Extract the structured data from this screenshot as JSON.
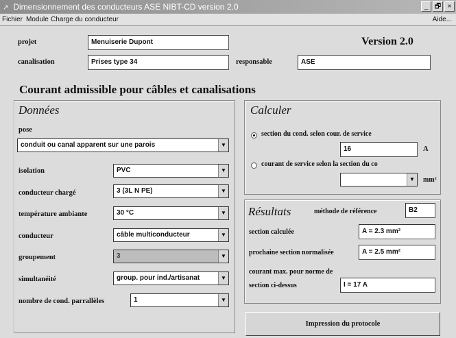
{
  "window": {
    "title": "Dimensionnement des conducteurs ASE NIBT-CD version 2.0",
    "controls": {
      "minimize": "_",
      "maximize": "🗗",
      "close": "×"
    }
  },
  "menu": {
    "file": "Fichier",
    "module": "Module",
    "charge": "Charge du conducteur",
    "help": "Aide..."
  },
  "header": {
    "projet_label": "projet",
    "projet_value": "Menuiserie Dupont",
    "version": "Version 2.0",
    "canalisation_label": "canalisation",
    "canalisation_value": "Prises type 34",
    "responsable_label": "responsable",
    "responsable_value": "ASE"
  },
  "main_title": "Courant admissible pour câbles et canalisations",
  "donnees": {
    "title": "Données",
    "pose_label": "pose",
    "pose_value": "conduit ou canal apparent sur une parois",
    "isolation_label": "isolation",
    "isolation_value": "PVC",
    "conducteur_charge_label": "conducteur chargé",
    "conducteur_charge_value": "3 (3L N PE)",
    "temperature_label": "température ambiante",
    "temperature_value": "30 °C",
    "conducteur_label": "conducteur",
    "conducteur_value": "câble multiconducteur",
    "groupement_label": "groupement",
    "groupement_value": "3",
    "simultaneite_label": "simultanéité",
    "simultaneite_value": "group. pour ind./artisanat",
    "nombre_label": "nombre de cond. parrallèles",
    "nombre_value": "1",
    "arrow_glyph": "▼"
  },
  "calculer": {
    "title": "Calculer",
    "option1": "section du cond. selon cour. de service",
    "courant_value": "16",
    "courant_unit": "A",
    "option2": "courant de service selon la section du co",
    "section_value": "",
    "section_unit": "mm²"
  },
  "resultats": {
    "title": "Résultats",
    "methode_label": "méthode de référence",
    "methode_value": "B2",
    "section_calc_label": "section calculée",
    "section_calc_value": "A = 2.3 mm²",
    "section_norm_label": "prochaine section normalisée",
    "section_norm_value": "A = 2.5 mm²",
    "courant_max_label_1": "courant max. pour norme de",
    "courant_max_label_2": "section ci-dessus",
    "courant_max_value": "I = 17 A"
  },
  "print_button": "Impression du protocole"
}
